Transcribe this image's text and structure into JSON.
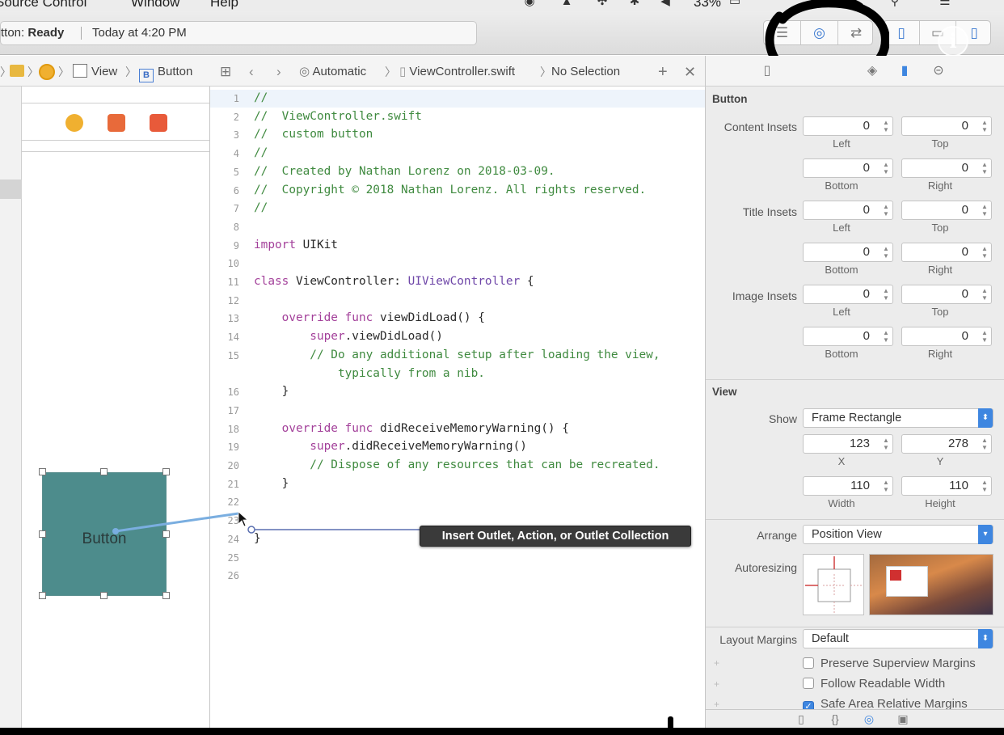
{
  "menubar": {
    "items": [
      "Source Control",
      "Window",
      "Help"
    ],
    "battery": "33%"
  },
  "toolbar": {
    "scheme_label": "tton:",
    "status": "Ready",
    "time": "Today at 4:20 PM",
    "info_glyph": "i"
  },
  "storyboard": {
    "breadcrumbs": [
      "View",
      "Button"
    ],
    "button_title": "Button",
    "button_color": "#4d8c8c"
  },
  "editor": {
    "jumpbar": {
      "mode": "Automatic",
      "file": "ViewController.swift",
      "selection": "No Selection"
    },
    "lines": [
      {
        "n": "1",
        "text": "//",
        "type": "comment"
      },
      {
        "n": "2",
        "text": "//  ViewController.swift",
        "type": "comment"
      },
      {
        "n": "3",
        "text": "//  custom button",
        "type": "comment"
      },
      {
        "n": "4",
        "text": "//",
        "type": "comment"
      },
      {
        "n": "5",
        "text": "//  Created by Nathan Lorenz on 2018-03-09.",
        "type": "comment"
      },
      {
        "n": "6",
        "text": "//  Copyright © 2018 Nathan Lorenz. All rights reserved.",
        "type": "comment"
      },
      {
        "n": "7",
        "text": "//",
        "type": "comment"
      },
      {
        "n": "8",
        "text": "",
        "type": "plain"
      },
      {
        "n": "9",
        "kw": "import",
        "rest": " UIKit",
        "type": "kw"
      },
      {
        "n": "10",
        "text": "",
        "type": "plain"
      },
      {
        "n": "11",
        "kw": "class",
        "rest": " ViewController: ",
        "typename": "UIViewController",
        "tail": " {",
        "type": "class"
      },
      {
        "n": "12",
        "text": "",
        "type": "plain"
      },
      {
        "n": "13",
        "kw": "    override func",
        "rest": " viewDidLoad() {",
        "type": "kw"
      },
      {
        "n": "14",
        "kw": "        super",
        "rest": ".viewDidLoad()",
        "type": "kw"
      },
      {
        "n": "15",
        "text": "        // Do any additional setup after loading the view,",
        "type": "comment"
      },
      {
        "n": "",
        "text": "            typically from a nib.",
        "type": "comment"
      },
      {
        "n": "16",
        "text": "    }",
        "type": "plain"
      },
      {
        "n": "17",
        "text": "",
        "type": "plain"
      },
      {
        "n": "18",
        "kw": "    override func",
        "rest": " didReceiveMemoryWarning() {",
        "type": "kw"
      },
      {
        "n": "19",
        "kw": "        super",
        "rest": ".didReceiveMemoryWarning()",
        "type": "kw"
      },
      {
        "n": "20",
        "text": "        // Dispose of any resources that can be recreated.",
        "type": "comment"
      },
      {
        "n": "21",
        "text": "    }",
        "type": "plain"
      },
      {
        "n": "22",
        "text": "",
        "type": "plain"
      },
      {
        "n": "23",
        "text": "",
        "type": "plain"
      },
      {
        "n": "24",
        "text": "}",
        "type": "plain"
      },
      {
        "n": "25",
        "text": "",
        "type": "plain"
      },
      {
        "n": "26",
        "text": "",
        "type": "plain"
      }
    ],
    "tooltip": "Insert Outlet, Action, or Outlet Collection"
  },
  "inspector": {
    "button_section": "Button",
    "content_insets": "Content Insets",
    "title_insets": "Title Insets",
    "image_insets": "Image Insets",
    "left": "Left",
    "top": "Top",
    "bottom": "Bottom",
    "right": "Right",
    "inset_value": "0",
    "view_section": "View",
    "show_label": "Show",
    "show_value": "Frame Rectangle",
    "x_value": "123",
    "y_value": "278",
    "x_label": "X",
    "y_label": "Y",
    "width_value": "110",
    "height_value": "110",
    "width_label": "Width",
    "height_label": "Height",
    "arrange_label": "Arrange",
    "arrange_value": "Position View",
    "autoresizing_label": "Autoresizing",
    "layout_margins_label": "Layout Margins",
    "layout_margins_value": "Default",
    "checks": [
      {
        "label": "Preserve Superview Margins",
        "checked": false
      },
      {
        "label": "Follow Readable Width",
        "checked": false
      },
      {
        "label": "Safe Area Relative Margins",
        "checked": true
      }
    ]
  },
  "colors": {
    "accent": "#3e86e0",
    "comment": "#3f8a3f",
    "keyword": "#a3409a"
  }
}
